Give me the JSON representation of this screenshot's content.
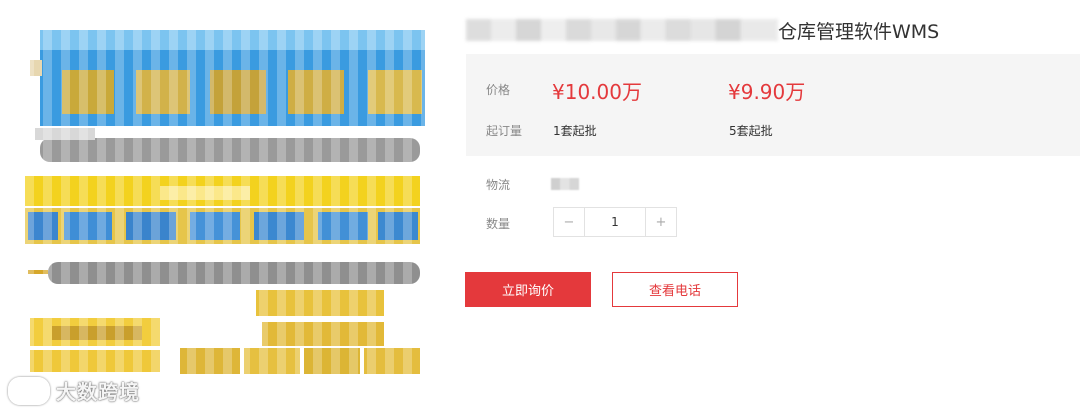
{
  "product": {
    "title_visible_suffix": "仓库管理软件WMS",
    "image_watermark": "大数跨境"
  },
  "pricing": {
    "price_label": "价格",
    "tier1_price": "¥10.00万",
    "tier2_price": "¥9.90万",
    "moq_label": "起订量",
    "tier1_moq": "1套起批",
    "tier2_moq": "5套起批"
  },
  "logistics": {
    "label": "物流"
  },
  "quantity": {
    "label": "数量",
    "value": "1",
    "minus_symbol": "−",
    "plus_symbol": "+"
  },
  "actions": {
    "inquire_label": "立即询价",
    "phone_label": "查看电话"
  },
  "colors": {
    "accent": "#e4393c",
    "panel_bg": "#f5f5f5"
  }
}
